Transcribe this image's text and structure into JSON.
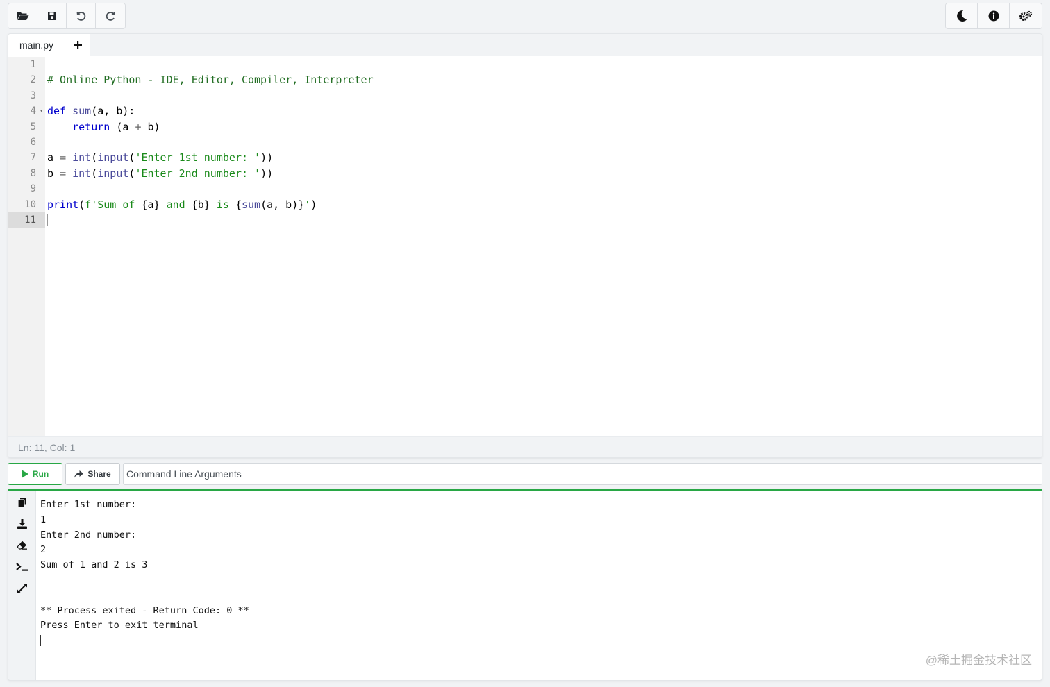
{
  "toolbar": {
    "left_buttons": [
      {
        "icon": "folder-open-icon"
      },
      {
        "icon": "save-icon"
      },
      {
        "icon": "undo-icon"
      },
      {
        "icon": "redo-icon"
      }
    ],
    "right_buttons": [
      {
        "icon": "moon-icon"
      },
      {
        "icon": "info-icon"
      },
      {
        "icon": "cogs-icon"
      }
    ]
  },
  "editor": {
    "tab_label": "main.py",
    "add_tab_label": "+",
    "line_numbers": [
      "1",
      "2",
      "3",
      "4",
      "5",
      "6",
      "7",
      "8",
      "9",
      "10",
      "11"
    ],
    "lines": [
      [],
      [
        {
          "t": "comment",
          "v": "# Online Python - IDE, Editor, Compiler, Interpreter"
        }
      ],
      [],
      [
        {
          "t": "kw",
          "v": "def"
        },
        {
          "t": "plain",
          "v": " "
        },
        {
          "t": "fn",
          "v": "sum"
        },
        {
          "t": "plain",
          "v": "(a, b):"
        }
      ],
      [
        {
          "t": "plain",
          "v": "    "
        },
        {
          "t": "kw",
          "v": "return"
        },
        {
          "t": "plain",
          "v": " (a "
        },
        {
          "t": "op",
          "v": "+"
        },
        {
          "t": "plain",
          "v": " b)"
        }
      ],
      [],
      [
        {
          "t": "plain",
          "v": "a "
        },
        {
          "t": "op",
          "v": "="
        },
        {
          "t": "plain",
          "v": " "
        },
        {
          "t": "fn",
          "v": "int"
        },
        {
          "t": "plain",
          "v": "("
        },
        {
          "t": "fn",
          "v": "input"
        },
        {
          "t": "plain",
          "v": "("
        },
        {
          "t": "str",
          "v": "'Enter 1st number: '"
        },
        {
          "t": "plain",
          "v": "))"
        }
      ],
      [
        {
          "t": "plain",
          "v": "b "
        },
        {
          "t": "op",
          "v": "="
        },
        {
          "t": "plain",
          "v": " "
        },
        {
          "t": "fn",
          "v": "int"
        },
        {
          "t": "plain",
          "v": "("
        },
        {
          "t": "fn",
          "v": "input"
        },
        {
          "t": "plain",
          "v": "("
        },
        {
          "t": "str",
          "v": "'Enter 2nd number: '"
        },
        {
          "t": "plain",
          "v": "))"
        }
      ],
      [],
      [
        {
          "t": "kw",
          "v": "print"
        },
        {
          "t": "plain",
          "v": "("
        },
        {
          "t": "str",
          "v": "f'Sum of "
        },
        {
          "t": "plain",
          "v": "{a}"
        },
        {
          "t": "str",
          "v": " and "
        },
        {
          "t": "plain",
          "v": "{b}"
        },
        {
          "t": "str",
          "v": " is "
        },
        {
          "t": "plain",
          "v": "{"
        },
        {
          "t": "fn",
          "v": "sum"
        },
        {
          "t": "plain",
          "v": "(a, b)}"
        },
        {
          "t": "str",
          "v": "'"
        },
        {
          "t": "plain",
          "v": ")"
        }
      ],
      []
    ],
    "status": "Ln: 11,  Col: 1"
  },
  "runbar": {
    "run_label": "Run",
    "share_label": "Share",
    "args_placeholder": "Command Line Arguments"
  },
  "terminal": {
    "side_icons": [
      "copy-icon",
      "download-icon",
      "eraser-icon",
      "terminal-icon",
      "expand-icon"
    ],
    "output": [
      "Enter 1st number:",
      "1",
      "Enter 2nd number:",
      "2",
      "Sum of 1 and 2 is 3",
      "",
      "",
      "** Process exited - Return Code: 0 **",
      "Press Enter to exit terminal"
    ],
    "watermark": "@稀土掘金技术社区"
  },
  "colors": {
    "accent_green": "#28a745",
    "comment": "#236e24",
    "keyword": "#0000cd",
    "string": "#1a8a1a"
  }
}
